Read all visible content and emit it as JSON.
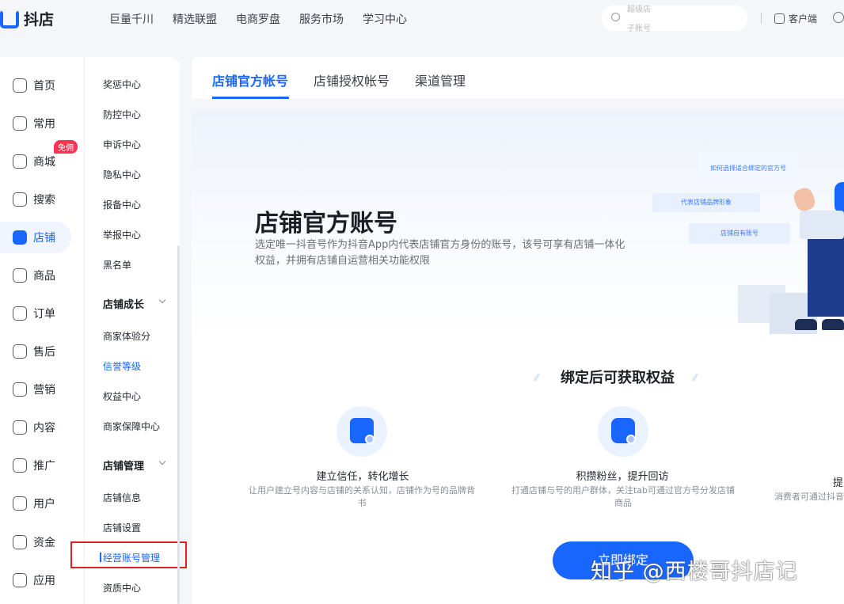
{
  "app": {
    "logo_text": "抖店"
  },
  "topnav": [
    "巨量千川",
    "精选联盟",
    "电商罗盘",
    "服务市场",
    "学习中心"
  ],
  "search": {
    "placeholder_top": "超级店",
    "placeholder_bottom": "子账号"
  },
  "header_right": {
    "client_label": "客户端"
  },
  "leftnav": [
    {
      "label": "首页",
      "icon": "home-icon"
    },
    {
      "label": "常用",
      "icon": "folder-icon"
    },
    {
      "label": "商城",
      "icon": "shop-icon",
      "badge": "免佣"
    },
    {
      "label": "搜索",
      "icon": "search-icon"
    },
    {
      "label": "店铺",
      "icon": "store-icon",
      "active": true
    },
    {
      "label": "商品",
      "icon": "bag-icon"
    },
    {
      "label": "订单",
      "icon": "order-icon"
    },
    {
      "label": "售后",
      "icon": "aftersale-icon"
    },
    {
      "label": "营销",
      "icon": "megaphone-icon"
    },
    {
      "label": "内容",
      "icon": "tv-icon"
    },
    {
      "label": "推广",
      "icon": "send-icon"
    },
    {
      "label": "用户",
      "icon": "user-icon"
    },
    {
      "label": "资金",
      "icon": "wallet-icon"
    },
    {
      "label": "应用",
      "icon": "app-icon"
    }
  ],
  "subnav": {
    "items_top": [
      "奖惩中心",
      "防控中心",
      "申诉中心",
      "隐私中心",
      "报备中心",
      "举报中心",
      "黑名单"
    ],
    "group_growth": {
      "title": "店铺成长",
      "items": [
        "商家体验分",
        "信誉等级",
        "权益中心",
        "商家保障中心"
      ]
    },
    "group_manage": {
      "title": "店铺管理",
      "items": [
        "店铺信息",
        "店铺设置",
        "经营账号管理",
        "资质中心"
      ]
    }
  },
  "tabs": [
    "店铺官方帐号",
    "店铺授权帐号",
    "渠道管理"
  ],
  "hero": {
    "title": "店铺官方账号",
    "desc": "选定唯一抖音号作为抖音App内代表店铺官方身份的账号，该号可享有店铺一体化权益，并拥有店铺自运营相关功能权限",
    "cards": [
      "如何选择适合绑定的官方号",
      "代表店铺品牌形象",
      "店铺自有账号"
    ]
  },
  "benefits": {
    "heading": "绑定后可获取权益",
    "items": [
      {
        "title": "建立信任，转化增长",
        "desc": "让用户建立号内容与店铺的关系认知，店铺作为号的品牌背书",
        "icon": "shopping-bag-icon"
      },
      {
        "title": "积攒粉丝，提升回访",
        "desc": "打通店铺与号的用户群体，关注tab可通过官方号分发店铺商品",
        "icon": "fans-icon"
      },
      {
        "title": "提",
        "desc": "消费者可通过抖音",
        "icon": ""
      }
    ]
  },
  "bind_button": "立即绑定",
  "watermark": "知乎 @西楼哥抖店记",
  "colors": {
    "accent": "#1966ff",
    "badge": "#fe3355",
    "highlight_box": "#e02020"
  }
}
